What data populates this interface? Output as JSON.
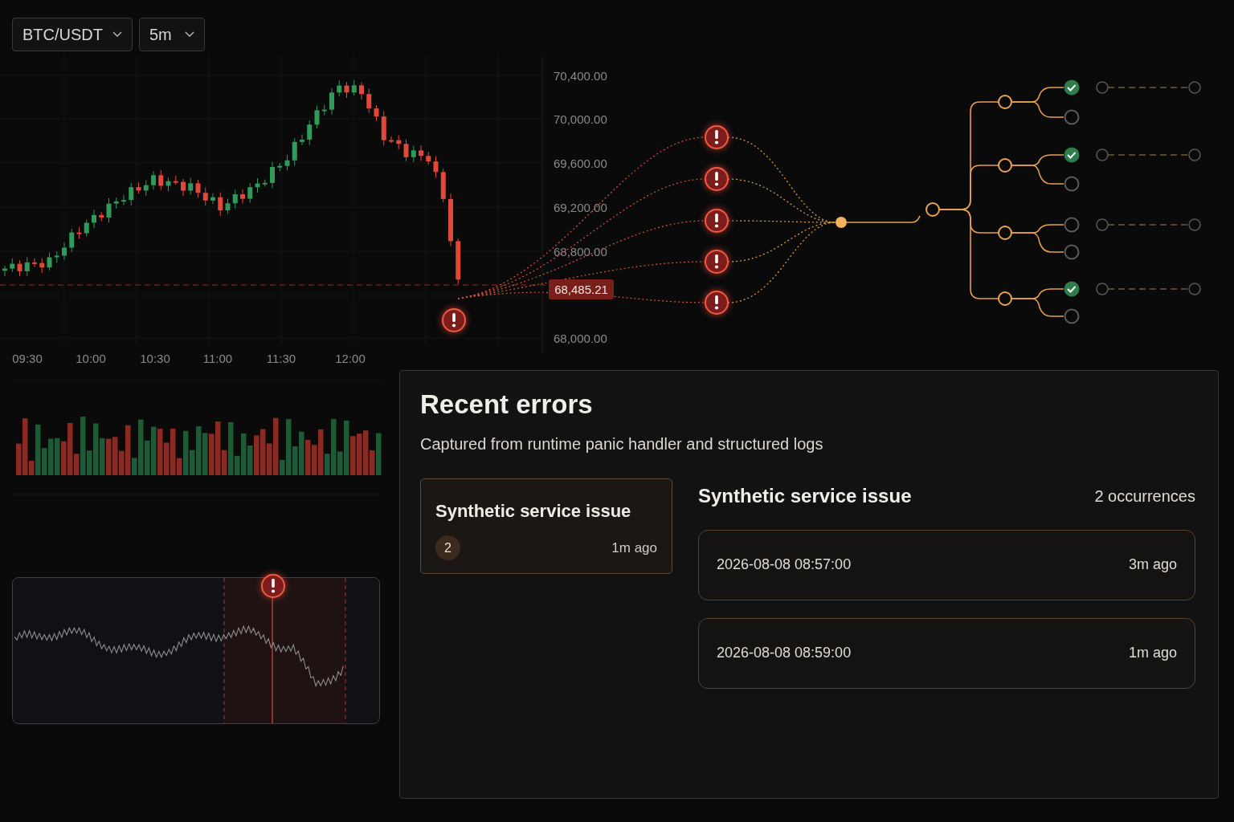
{
  "toolbar": {
    "dropdowns": [
      {
        "value": "BTC/USDT"
      },
      {
        "value": "5m"
      }
    ]
  },
  "price_chart": {
    "price_axis": [
      "70,400.00",
      "70,000.00",
      "69,600.00",
      "69,200.00",
      "68,800.00",
      "68,000.00"
    ],
    "time_axis": [
      "09:30",
      "10:00",
      "10:30",
      "11:00",
      "11:30",
      "12:00"
    ],
    "last_price": "68,485.21"
  },
  "alert_tree": {
    "branches": [
      {
        "leaves": [
          {
            "checked": true
          },
          {
            "checked": false
          }
        ]
      },
      {
        "leaves": [
          {
            "checked": true
          },
          {
            "checked": false
          }
        ]
      },
      {
        "leaves": [
          {
            "checked": false
          },
          {
            "checked": false
          }
        ]
      },
      {
        "leaves": [
          {
            "checked": true
          },
          {
            "checked": false
          }
        ]
      }
    ]
  },
  "errors_panel": {
    "title": "Recent errors",
    "subtitle": "Captured from runtime panic handler and structured logs",
    "issues": [
      {
        "title": "Synthetic service issue",
        "count": "2",
        "time": "1m ago",
        "selected": true
      }
    ],
    "detail": {
      "title": "Synthetic service issue",
      "occurrences_label": "2 occurrences",
      "occurrences": [
        {
          "timestamp": "2026-08-08 08:57:00",
          "ago": "3m ago"
        },
        {
          "timestamp": "2026-08-08 08:59:00",
          "ago": "1m ago"
        }
      ]
    }
  }
}
